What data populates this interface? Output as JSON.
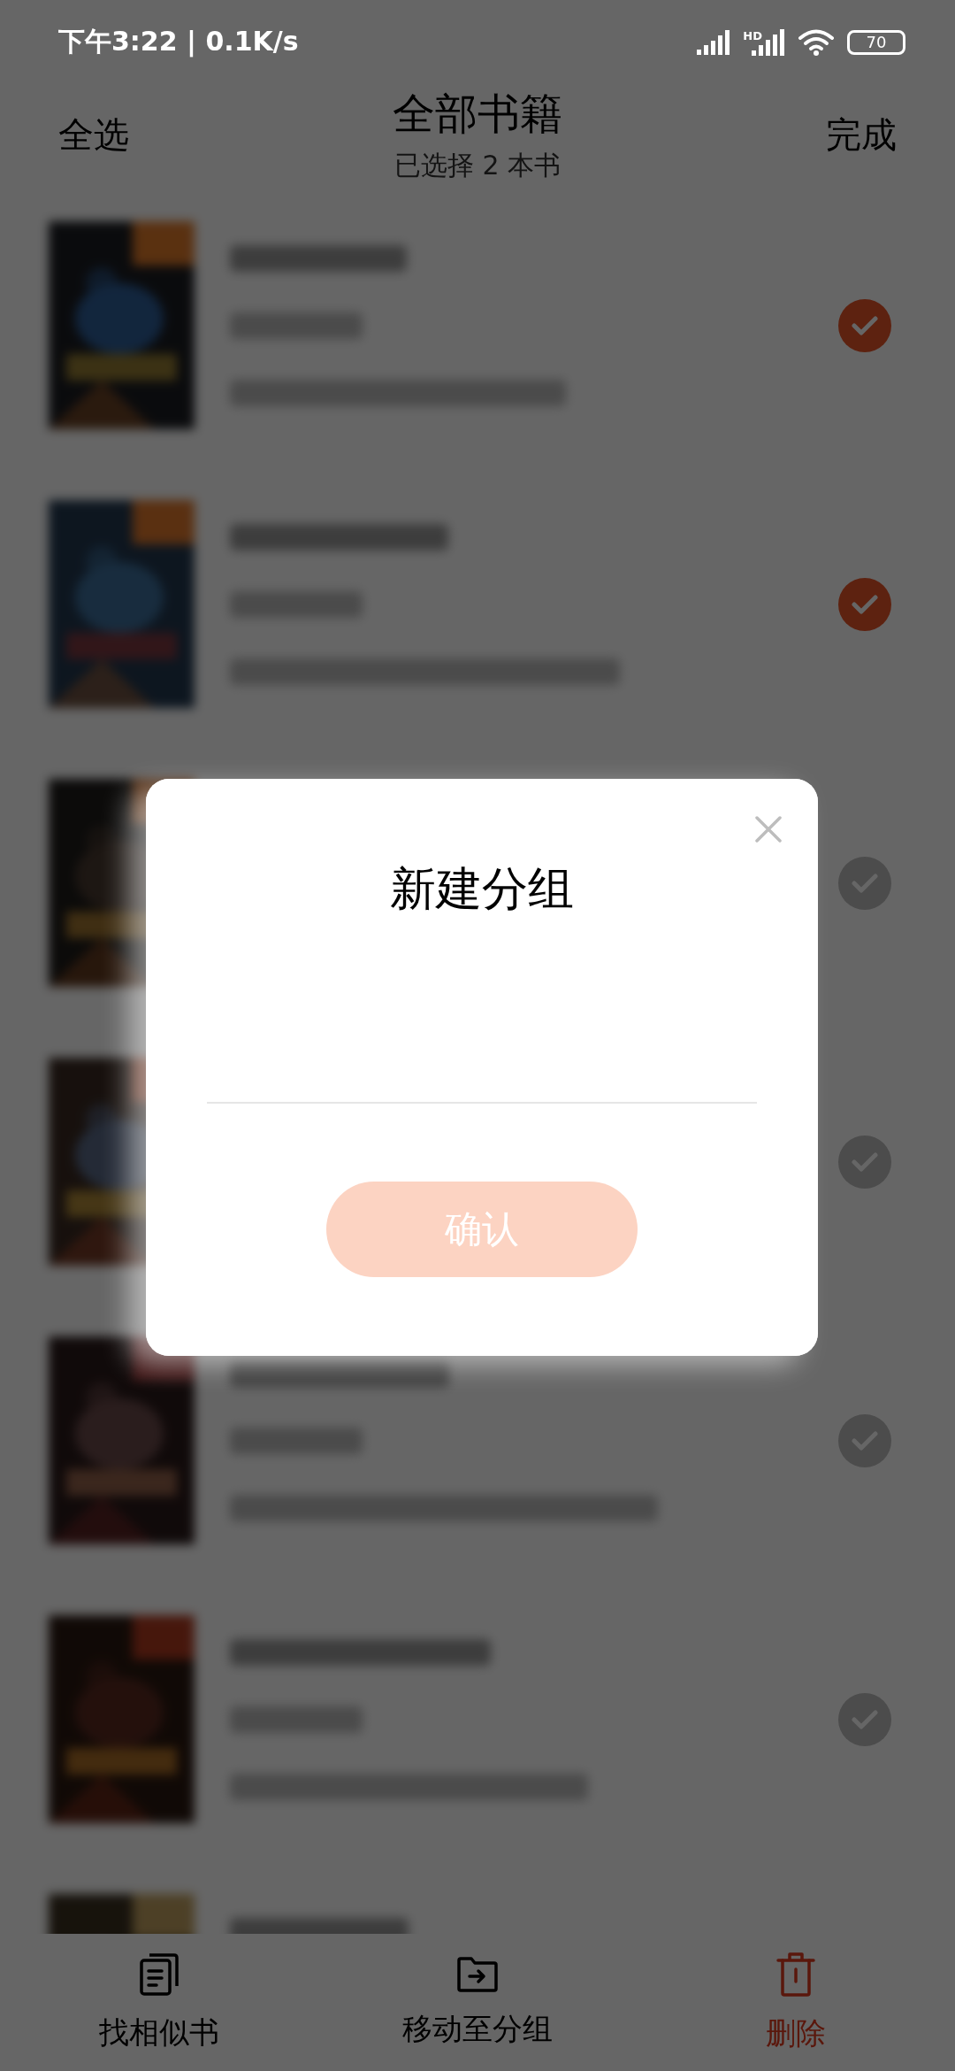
{
  "status_bar": {
    "time": "下午3:22 | 0.1K/s",
    "network_label": "HD",
    "battery": "70"
  },
  "header": {
    "select_all": "全选",
    "title": "全部书籍",
    "subtitle": "已选择 2 本书",
    "done": "完成"
  },
  "books": [
    {
      "cover": {
        "kind": "picture"
      },
      "selected": true
    },
    {
      "cover": {
        "kind": "picture"
      },
      "selected": true
    },
    {
      "cover": {
        "kind": "picture"
      },
      "selected": false
    },
    {
      "cover": {
        "kind": "picture"
      },
      "selected": false
    },
    {
      "cover": {
        "kind": "picture"
      },
      "selected": false
    },
    {
      "cover": {
        "kind": "picture"
      },
      "selected": false
    },
    {
      "cover": {
        "kind": "picture"
      }
    }
  ],
  "dialog": {
    "title": "新建分组",
    "confirm": {
      "label": "确认",
      "disabled": true
    }
  },
  "bottom_bar": [
    {
      "label": "找相似书",
      "kind": "similar"
    },
    {
      "label": "移动至分组",
      "kind": "move"
    },
    {
      "label": "删除",
      "kind": "delete"
    }
  ]
}
